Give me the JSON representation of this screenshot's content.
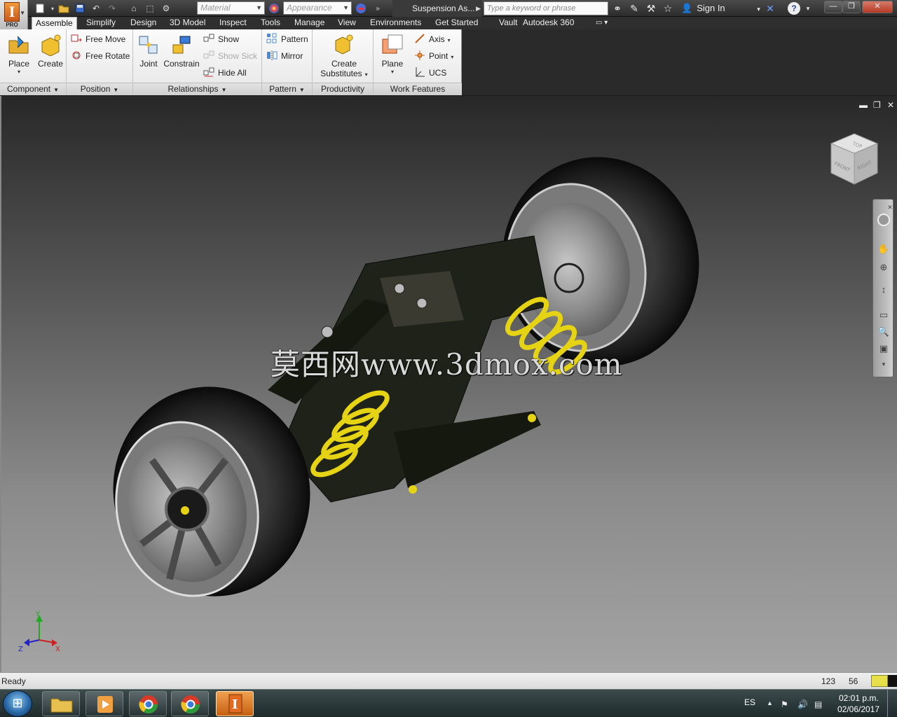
{
  "app": {
    "logo_letter": "I",
    "edition": "PRO"
  },
  "qat": {
    "material_placeholder": "Material",
    "appearance_placeholder": "Appearance",
    "document_title": "Suspension As...",
    "search_placeholder": "Type a keyword or phrase",
    "sign_in": "Sign In"
  },
  "tabs": [
    "Assemble",
    "Simplify",
    "Design",
    "3D Model",
    "Inspect",
    "Tools",
    "Manage",
    "View",
    "Environments",
    "Get Started",
    "Vault",
    "Autodesk 360"
  ],
  "active_tab": "Assemble",
  "ribbon": {
    "component": {
      "label": "Component",
      "place": "Place",
      "create": "Create"
    },
    "position": {
      "label": "Position",
      "free_move": "Free Move",
      "free_rotate": "Free Rotate"
    },
    "relationships": {
      "label": "Relationships",
      "joint": "Joint",
      "constrain": "Constrain",
      "show": "Show",
      "show_sick": "Show Sick",
      "hide_all": "Hide All"
    },
    "pattern": {
      "label": "Pattern",
      "pattern": "Pattern",
      "mirror": "Mirror"
    },
    "productivity": {
      "label": "Productivity",
      "create_substitutes_1": "Create",
      "create_substitutes_2": "Substitutes"
    },
    "work_features": {
      "label": "Work Features",
      "plane": "Plane",
      "axis": "Axis",
      "point": "Point",
      "ucs": "UCS"
    }
  },
  "viewcube": {
    "top": "TOP",
    "front": "FRONT",
    "right": "RIGHT"
  },
  "triad": {
    "x": "X",
    "y": "Y",
    "z": "Z"
  },
  "watermark": "莫西网www.3dmox.com",
  "status": {
    "text": "Ready",
    "num1": "123",
    "num2": "56"
  },
  "tray": {
    "language": "ES",
    "time": "02:01 p.m.",
    "date": "02/06/2017"
  },
  "colors": {
    "ribbon_bg": "#f4f4f4",
    "titlebar": "#333333",
    "spring_yellow": "#e6d414",
    "taskbar": "#2a3638"
  }
}
